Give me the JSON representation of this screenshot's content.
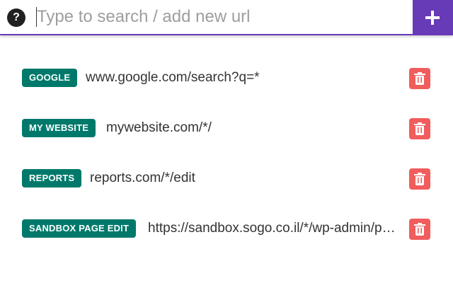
{
  "search": {
    "placeholder": "Type to search / add new url",
    "value": ""
  },
  "help": {
    "label": "?",
    "icon": "question-circle-icon"
  },
  "add": {
    "icon": "plus-icon"
  },
  "rules": [
    {
      "tag": "GOOGLE",
      "url": "www.google.com/search?q=*"
    },
    {
      "tag": "MY WEBSITE",
      "url": "mywebsite.com/*/"
    },
    {
      "tag": "REPORTS",
      "url": "reports.com/*/edit"
    },
    {
      "tag": "SANDBOX PAGE EDIT",
      "url": "https://sandbox.sogo.co.il/*/wp-admin/post.php"
    }
  ],
  "delete": {
    "icon": "trash-icon"
  },
  "colors": {
    "accent": "#673ab7",
    "tag": "#00796b",
    "delete": "#f15c5c",
    "text": "#333333"
  }
}
